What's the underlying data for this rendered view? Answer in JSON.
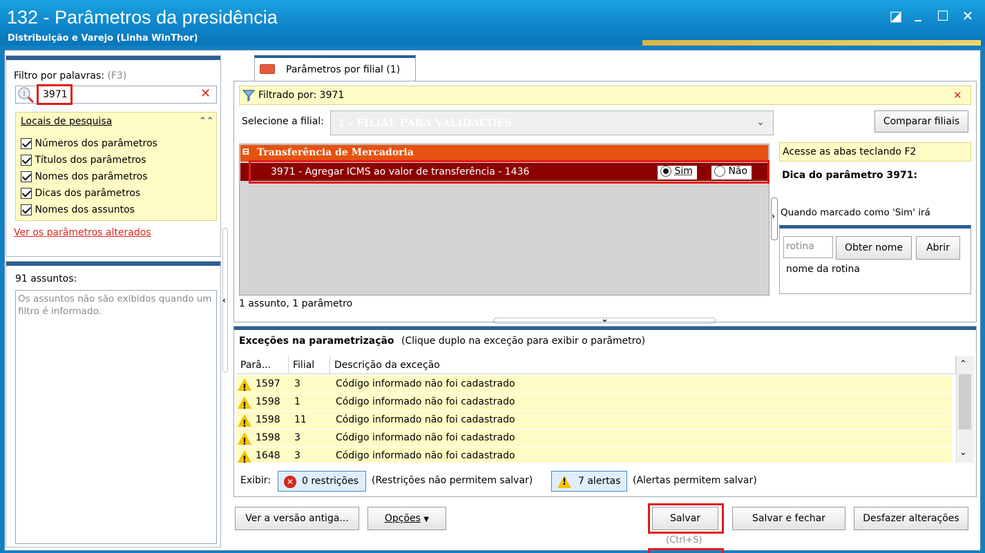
{
  "window": {
    "title": "132 - Parâmetros da presidência",
    "subtitle": "Distribuição e Varejo (Linha WinThor)",
    "controls": {
      "restore": "◪",
      "minimize": "_",
      "maximize": "☐",
      "close": "✕"
    }
  },
  "filter": {
    "label": "Filtro por palavras:",
    "shortcut": "(F3)",
    "value": "3971",
    "clear_icon": "✕",
    "locations_title": "Locais de pesquisa",
    "collapse_icon": "⌃⌃",
    "options": [
      {
        "label": "Números dos parâmetros",
        "checked": true
      },
      {
        "label": "Títulos dos parâmetros",
        "checked": true
      },
      {
        "label": "Nomes dos parâmetros",
        "checked": true
      },
      {
        "label": "Dicas dos parâmetros",
        "checked": true
      },
      {
        "label": "Nomes dos assuntos",
        "checked": true
      }
    ],
    "changed_link": "Ver os parâmetros alterados"
  },
  "subjects": {
    "count_label": "91 assuntos:",
    "empty_message": "Os assuntos não são exibidos quando um filtro é informado."
  },
  "tab": {
    "label": "Parâmetros por filial",
    "count": "(1)"
  },
  "filter_bar": {
    "text": "Filtrado por: 3971",
    "close": "✕"
  },
  "branch": {
    "label": "Selecione a filial:",
    "selected": "1 - FILIAL PARA VALIDACOES",
    "compare_button": "Comparar filiais"
  },
  "group": {
    "toggle": "⊟",
    "title": "Transferência de Mercadoria",
    "parameter": {
      "text": "3971 - Agregar ICMS ao valor de transferência - 1436",
      "options": [
        {
          "label": "Sim",
          "selected": true
        },
        {
          "label": "Não",
          "selected": false
        }
      ]
    }
  },
  "summary": "1 assunto, 1 parâmetro",
  "hint": {
    "access_tip": "Acesse as abas teclando F2",
    "title": "Dica do parâmetro 3971:",
    "text": "Quando marcado como 'Sim' irá",
    "routine_placeholder": "rotina",
    "get_name_button": "Obter nome",
    "open_button": "Abrir",
    "routine_name": "nome da rotina"
  },
  "exceptions": {
    "title": "Exceções na parametrização",
    "subtitle": "(Clique duplo na exceção para exibir o parâmetro)",
    "columns": [
      "Parâ...",
      "Filial",
      "Descrição da exceção"
    ],
    "rows": [
      {
        "param": "1597",
        "branch": "3",
        "description": "Código informado não foi cadastrado"
      },
      {
        "param": "1598",
        "branch": "1",
        "description": "Código informado não foi cadastrado"
      },
      {
        "param": "1598",
        "branch": "11",
        "description": "Código informado não foi cadastrado"
      },
      {
        "param": "1598",
        "branch": "3",
        "description": "Código informado não foi cadastrado"
      },
      {
        "param": "1648",
        "branch": "3",
        "description": "Código informado não foi cadastrado"
      }
    ],
    "show_label": "Exibir:",
    "restrictions_button": "0 restrições",
    "restrictions_note": "(Restrições não permitem salvar)",
    "alerts_button": "7 alertas",
    "alerts_note": "(Alertas permitem salvar)"
  },
  "footer": {
    "old_version_button": "Ver a versão antiga...",
    "options_button": "Opções",
    "save_button": "Salvar",
    "save_shortcut": "(Ctrl+S)",
    "save_close_button": "Salvar e fechar",
    "undo_button": "Desfazer alterações"
  },
  "colors": {
    "title_bar": "#0f83c8",
    "group_header": "#e5520f",
    "selected_row": "#8c0000",
    "highlight": "#e01b1b",
    "hint_bg": "#fffbc4"
  }
}
